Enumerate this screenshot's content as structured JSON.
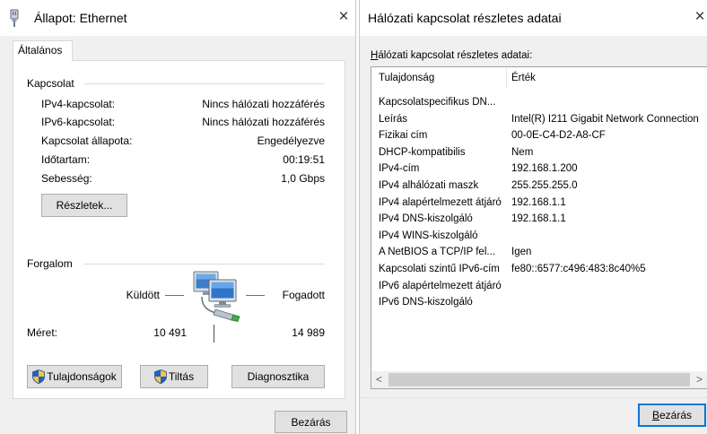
{
  "colors": {
    "accent": "#0078d7",
    "dialog_background": "#f0f0f0",
    "shield_blue": "#1f63c4",
    "shield_yellow": "#f6c343"
  },
  "status_dialog": {
    "title": "Állapot: Ethernet",
    "title_icon": "network-adapter-icon",
    "close_glyph": "×",
    "tabs": [
      {
        "label": "Általános"
      }
    ],
    "connection": {
      "heading": "Kapcsolat",
      "rows": [
        {
          "label": "IPv4-kapcsolat:",
          "value": "Nincs hálózati hozzáférés"
        },
        {
          "label": "IPv6-kapcsolat:",
          "value": "Nincs hálózati hozzáférés"
        },
        {
          "label": "Kapcsolat állapota:",
          "value": "Engedélyezve"
        },
        {
          "label": "Időtartam:",
          "value": "00:19:51"
        },
        {
          "label": "Sebesség:",
          "value": "1,0 Gbps"
        }
      ]
    },
    "details_button": "Részletek...",
    "activity": {
      "heading": "Forgalom",
      "icon": "network-computers-icon",
      "sent_label": "Küldött",
      "received_label": "Fogadott",
      "bytes_label": "Méret:",
      "bytes_sent": "10 491",
      "bytes_received": "14 989"
    },
    "actions": [
      {
        "label": "Tulajdonságok",
        "icon": "uac-shield-icon"
      },
      {
        "label": "Tiltás",
        "icon": "uac-shield-icon"
      },
      {
        "label": "Diagnosztika"
      }
    ],
    "close_button": "Bezárás"
  },
  "details_dialog": {
    "title": "Hálózati kapcsolat részletes adatai",
    "close_glyph": "×",
    "list_label": "Hálózati kapcsolat részletes adatai:",
    "columns": [
      "Tulajdonság",
      "Érték"
    ],
    "rows": [
      {
        "property": "Kapcsolatspecifikus DN...",
        "value": ""
      },
      {
        "property": "Leírás",
        "value": "Intel(R) I211 Gigabit Network Connection"
      },
      {
        "property": "Fizikai cím",
        "value": "00-0E-C4-D2-A8-CF"
      },
      {
        "property": "DHCP-kompatibilis",
        "value": "Nem"
      },
      {
        "property": "IPv4-cím",
        "value": "192.168.1.200"
      },
      {
        "property": "IPv4 alhálózati maszk",
        "value": "255.255.255.0"
      },
      {
        "property": "IPv4 alapértelmezett átjáró",
        "value": "192.168.1.1"
      },
      {
        "property": "IPv4 DNS-kiszolgáló",
        "value": "192.168.1.1"
      },
      {
        "property": "IPv4 WINS-kiszolgáló",
        "value": ""
      },
      {
        "property": "A NetBIOS a TCP/IP fel...",
        "value": "Igen"
      },
      {
        "property": "Kapcsolati szintű IPv6-cím",
        "value": "fe80::6577:c496:483:8c40%5"
      },
      {
        "property": "IPv6 alapértelmezett átjáró",
        "value": ""
      },
      {
        "property": "IPv6 DNS-kiszolgáló",
        "value": ""
      }
    ],
    "scroll_left_glyph": "<",
    "scroll_right_glyph": ">",
    "close_button": "Bezárás"
  }
}
